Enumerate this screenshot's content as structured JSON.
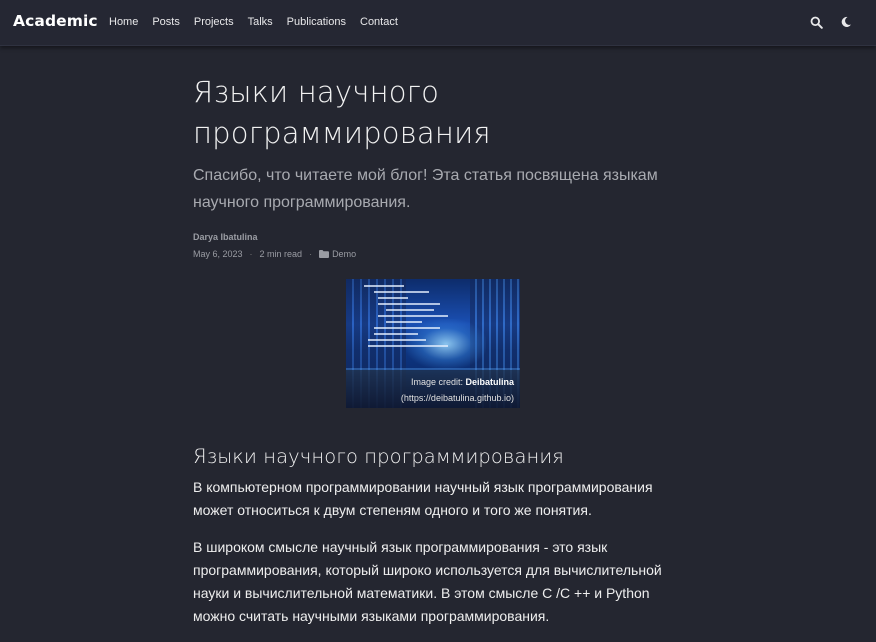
{
  "navbar": {
    "brand": "Academic",
    "links": [
      "Home",
      "Posts",
      "Projects",
      "Talks",
      "Publications",
      "Contact"
    ],
    "icons": [
      "search-icon",
      "moon-icon"
    ]
  },
  "article": {
    "title": "Языки научного программирования",
    "subtitle": "Спасибо, что читаете мой блог! Эта статья посвящена языкам научного программирования.",
    "author": "Darya Ibatulina",
    "date": "May 6, 2023",
    "read_time": "2 min read",
    "category": "Demo",
    "separator": "·"
  },
  "figure": {
    "caption_prefix": "Image credit: ",
    "caption_author": "Deibatulina",
    "caption_link": "(https://deibatulina.github.io)"
  },
  "section": {
    "heading": "Языки научного программирования",
    "paragraphs": [
      "В компьютерном программировании научный язык программирования может относиться к двум степеням одного и того же понятия.",
      "В широком смысле научный язык программирования - это язык программирования, который широко используется для вычислительной науки и вычислительной математики. В этом смысле C /C ++ и Python можно считать научными языками программирования."
    ]
  },
  "colors": {
    "background": "#242630",
    "navbar": "#252733",
    "text": "#eeeeee",
    "muted": "#9a9ca3"
  }
}
